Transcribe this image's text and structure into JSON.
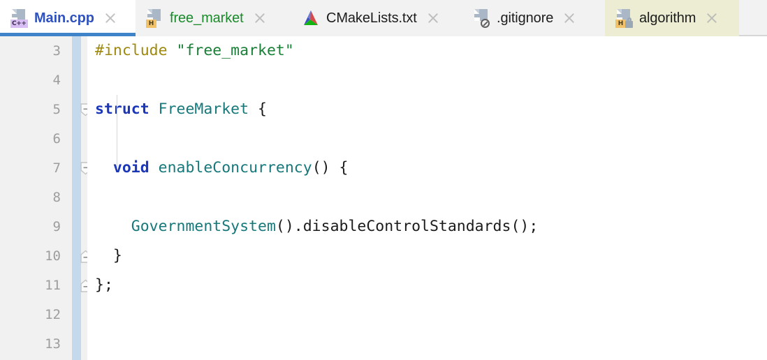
{
  "tabs": [
    {
      "label": "Main.cpp",
      "icon": "cpp-file-icon",
      "badge": "C++",
      "state": "active",
      "label_color": "#2f52bf",
      "close_icon": "close-icon"
    },
    {
      "label": "free_market",
      "icon": "header-file-icon",
      "badge": "H",
      "state": "inactive",
      "label_color": "#1a8a2b",
      "close_icon": "close-icon"
    },
    {
      "label": "CMakeLists.txt",
      "icon": "cmake-logo-icon",
      "badge": "",
      "state": "inactive",
      "label_color": "#1c1c1c",
      "close_icon": "close-icon"
    },
    {
      "label": ".gitignore",
      "icon": "gitignore-file-icon",
      "badge": "",
      "state": "inactive",
      "label_color": "#1c1c1c",
      "close_icon": "close-icon"
    },
    {
      "label": "algorithm",
      "icon": "header-file-locked-icon",
      "badge": "H",
      "state": "locked",
      "label_color": "#1c1c1c",
      "close_icon": "close-icon"
    }
  ],
  "editor": {
    "first_visible_line": 3,
    "line_numbers": [
      3,
      4,
      5,
      6,
      7,
      8,
      9,
      10,
      11,
      12,
      13
    ],
    "lines": [
      {
        "number": 3,
        "text": "#include \"free_market\"",
        "fold": ""
      },
      {
        "number": 4,
        "text": "",
        "fold": ""
      },
      {
        "number": 5,
        "text": "struct FreeMarket {",
        "fold": "collapse-start"
      },
      {
        "number": 6,
        "text": "",
        "fold": ""
      },
      {
        "number": 7,
        "text": "  void enableConcurrency() {",
        "fold": "collapse-start"
      },
      {
        "number": 8,
        "text": "",
        "fold": ""
      },
      {
        "number": 9,
        "text": "    GovernmentSystem().disableControlStandards();",
        "fold": ""
      },
      {
        "number": 10,
        "text": "  }",
        "fold": "collapse-end"
      },
      {
        "number": 11,
        "text": "};",
        "fold": "collapse-end"
      },
      {
        "number": 12,
        "text": "",
        "fold": ""
      },
      {
        "number": 13,
        "text": "",
        "fold": ""
      }
    ],
    "tokens": {
      "l3_include": "#include",
      "l3_space": " ",
      "l3_string": "\"free_market\"",
      "l5_struct": "struct",
      "l5_space": " ",
      "l5_name": "FreeMarket",
      "l5_brace": " {",
      "l7_indent": "  ",
      "l7_void": "void",
      "l7_space": " ",
      "l7_fn": "enableConcurrency",
      "l7_tail": "() {",
      "l9_indent": "    ",
      "l9_obj": "GovernmentSystem",
      "l9_mid": "().",
      "l9_call": "disableControlStandards();",
      "l10_text": "  }",
      "l11_text": "};"
    }
  },
  "colors": {
    "active_tab_underline": "#3f84c9",
    "locked_tab_bg": "#ecedd3",
    "tabbar_bg": "#f2f2f2",
    "gutter_bg": "#f1f1f1",
    "change_marker": "#c5d9ec",
    "editor_bg": "#ffffff",
    "linenum_fg": "#9d9d9d",
    "preprocessor": "#9e880d",
    "string": "#1a7f37",
    "keyword": "#1b37b8",
    "type": "#16787a"
  }
}
